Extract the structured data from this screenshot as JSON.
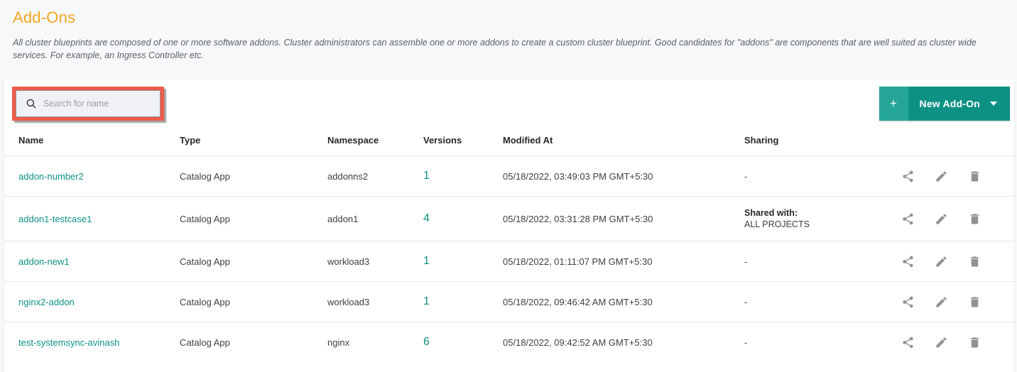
{
  "header": {
    "title": "Add-Ons",
    "description": "All cluster blueprints are composed of one or more software addons. Cluster administrators can assemble one or more addons to create a custom cluster blueprint. Good candidates for \"addons\" are components that are well suited as cluster wide services. For example, an Ingress Controller etc."
  },
  "toolbar": {
    "search": {
      "placeholder": "Search for name",
      "value": "",
      "icon": "search-icon",
      "highlight_color": "#ef5a4a"
    },
    "new_button": {
      "plus_label": "+",
      "label": "New Add-On",
      "caret": "chevron-down-icon",
      "color": "#0d9184",
      "plus_color": "#26a699"
    }
  },
  "table": {
    "columns": [
      "Name",
      "Type",
      "Namespace",
      "Versions",
      "Modified At",
      "Sharing",
      ""
    ],
    "rows": [
      {
        "name": "addon-number2",
        "type": "Catalog App",
        "namespace": "addonns2",
        "versions": "1",
        "modified_at": "05/18/2022, 03:49:03 PM GMT+5:30",
        "sharing_title": "",
        "sharing_value": "-",
        "actions": [
          "share-icon",
          "edit-icon",
          "delete-icon"
        ]
      },
      {
        "name": "addon1-testcase1",
        "type": "Catalog App",
        "namespace": "addon1",
        "versions": "4",
        "modified_at": "05/18/2022, 03:31:28 PM GMT+5:30",
        "sharing_title": "Shared with:",
        "sharing_value": "ALL PROJECTS",
        "actions": [
          "share-icon",
          "edit-icon",
          "delete-icon"
        ]
      },
      {
        "name": "addon-new1",
        "type": "Catalog App",
        "namespace": "workload3",
        "versions": "1",
        "modified_at": "05/18/2022, 01:11:07 PM GMT+5:30",
        "sharing_title": "",
        "sharing_value": "-",
        "actions": [
          "share-icon",
          "edit-icon",
          "delete-icon"
        ]
      },
      {
        "name": "nginx2-addon",
        "type": "Catalog App",
        "namespace": "workload3",
        "versions": "1",
        "modified_at": "05/18/2022, 09:46:42 AM GMT+5:30",
        "sharing_title": "",
        "sharing_value": "-",
        "actions": [
          "share-icon",
          "edit-icon",
          "delete-icon"
        ]
      },
      {
        "name": "test-systemsync-avinash",
        "type": "Catalog App",
        "namespace": "nginx",
        "versions": "6",
        "modified_at": "05/18/2022, 09:42:52 AM GMT+5:30",
        "sharing_title": "",
        "sharing_value": "-",
        "actions": [
          "share-icon",
          "edit-icon",
          "delete-icon"
        ]
      }
    ]
  },
  "colors": {
    "title": "#f5a623",
    "link": "#0d9184",
    "page_bg": "#f7f8fa",
    "card_bg": "#ffffff"
  }
}
